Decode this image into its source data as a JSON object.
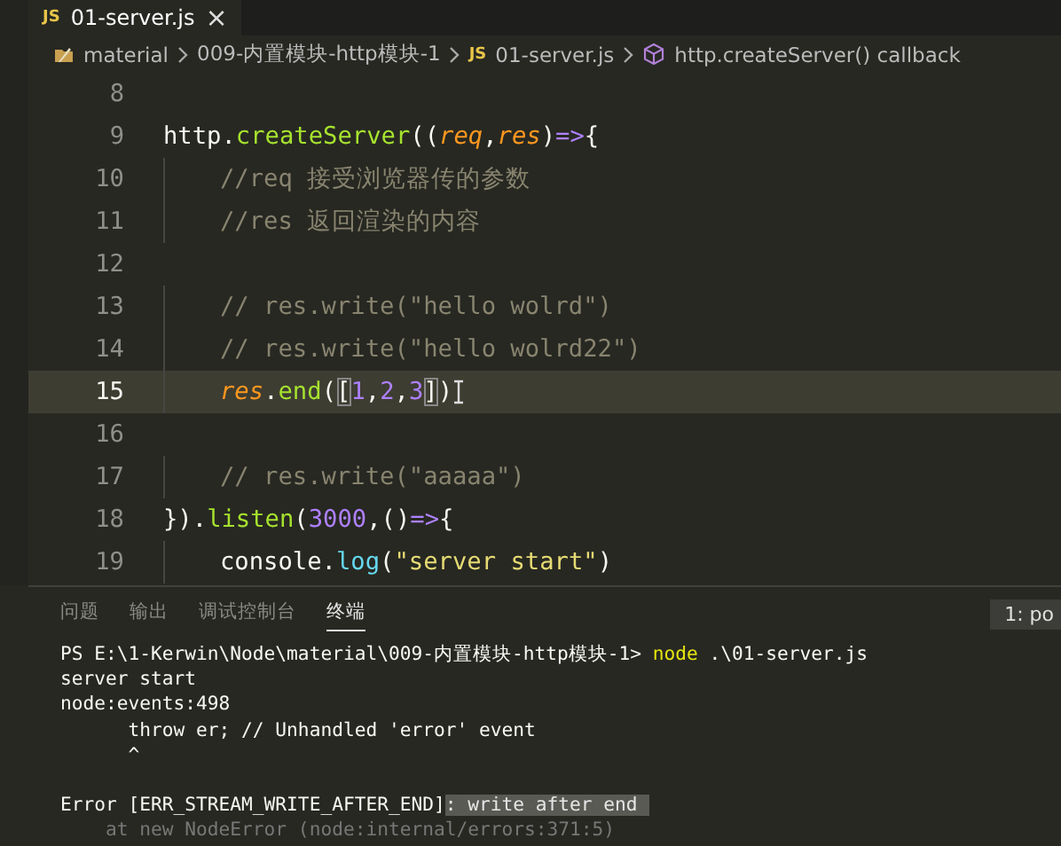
{
  "editor_tabs": [
    {
      "badge": "JS",
      "label": "01-server.js",
      "close": "×",
      "selected": true
    }
  ],
  "breadcrumb": [
    {
      "kind": "folder",
      "label": "material"
    },
    {
      "kind": "folder-plain",
      "label": "009-内置模块-http模块-1"
    },
    {
      "kind": "file",
      "badge": "JS",
      "label": "01-server.js"
    },
    {
      "kind": "symbol",
      "label": "http.createServer() callback"
    }
  ],
  "editor": {
    "lines": [
      {
        "number": "8",
        "current": false
      },
      {
        "number": "9",
        "current": false,
        "tokens": [
          {
            "text": "http.",
            "kind": "plain"
          },
          {
            "text": "createServer",
            "kind": "func"
          },
          {
            "text": "((",
            "kind": "plain"
          },
          {
            "text": "req",
            "kind": "param"
          },
          {
            "text": ",",
            "kind": "plain"
          },
          {
            "text": "res",
            "kind": "param"
          },
          {
            "text": ")",
            "kind": "plain"
          },
          {
            "text": "=>",
            "kind": "operator"
          },
          {
            "text": "{",
            "kind": "plain"
          }
        ]
      },
      {
        "number": "10",
        "current": false,
        "indent": true,
        "tokens": [
          {
            "text": "//req 接受浏览器传的参数",
            "kind": "comment"
          }
        ]
      },
      {
        "number": "11",
        "current": false,
        "indent": true,
        "tokens": [
          {
            "text": "//res 返回渲染的内容",
            "kind": "comment"
          }
        ]
      },
      {
        "number": "12",
        "current": false
      },
      {
        "number": "13",
        "current": false,
        "indent": true,
        "tokens": [
          {
            "text": "// res.write(\"hello wolrd\")",
            "kind": "comment"
          }
        ]
      },
      {
        "number": "14",
        "current": false,
        "indent": true,
        "tokens": [
          {
            "text": "// res.write(\"hello wolrd22\")",
            "kind": "comment"
          }
        ]
      },
      {
        "number": "15",
        "current": true,
        "indent": true,
        "tokens": [
          {
            "text": "res",
            "kind": "param"
          },
          {
            "text": ".",
            "kind": "plain"
          },
          {
            "text": "end",
            "kind": "func"
          },
          {
            "text": "(",
            "kind": "plain"
          },
          {
            "text": "[",
            "kind": "bracket-match"
          },
          {
            "text": "1",
            "kind": "number"
          },
          {
            "text": ",",
            "kind": "plain"
          },
          {
            "text": "2",
            "kind": "number"
          },
          {
            "text": ",",
            "kind": "plain"
          },
          {
            "text": "3",
            "kind": "number"
          },
          {
            "text": "]",
            "kind": "bracket-match"
          },
          {
            "text": ")",
            "kind": "plain"
          }
        ]
      },
      {
        "number": "16",
        "current": false
      },
      {
        "number": "17",
        "current": false,
        "indent": true,
        "tokens": [
          {
            "text": "// res.write(\"aaaaa\")",
            "kind": "comment"
          }
        ]
      },
      {
        "number": "18",
        "current": false,
        "tokens": [
          {
            "text": "}).",
            "kind": "plain"
          },
          {
            "text": "listen",
            "kind": "func"
          },
          {
            "text": "(",
            "kind": "plain"
          },
          {
            "text": "3000",
            "kind": "number"
          },
          {
            "text": ",()",
            "kind": "plain"
          },
          {
            "text": "=>",
            "kind": "operator"
          },
          {
            "text": "{",
            "kind": "plain"
          }
        ]
      },
      {
        "number": "19",
        "current": false,
        "indent": true,
        "tokens": [
          {
            "text": "console.",
            "kind": "plain"
          },
          {
            "text": "log",
            "kind": "method"
          },
          {
            "text": "(",
            "kind": "plain"
          },
          {
            "text": "\"server start\"",
            "kind": "string"
          },
          {
            "text": ")",
            "kind": "plain"
          }
        ]
      }
    ]
  },
  "panel": {
    "tabs": [
      {
        "label": "问题",
        "selected": false
      },
      {
        "label": "输出",
        "selected": false
      },
      {
        "label": "调试控制台",
        "selected": false
      },
      {
        "label": "终端",
        "selected": true
      }
    ],
    "terminal_selector": "1: po",
    "terminal_lines": [
      {
        "tokens": [
          {
            "text": "PS E:\\1-Kerwin\\Node\\material\\009-内置模块-http模块-1> ",
            "kind": "plain"
          },
          {
            "text": "node",
            "kind": "command"
          },
          {
            "text": " .\\01-server.js",
            "kind": "plain"
          }
        ]
      },
      {
        "tokens": [
          {
            "text": "server start",
            "kind": "plain"
          }
        ]
      },
      {
        "tokens": [
          {
            "text": "node:events:498",
            "kind": "plain"
          }
        ]
      },
      {
        "tokens": [
          {
            "text": "      throw er; // Unhandled 'error' event",
            "kind": "plain"
          }
        ]
      },
      {
        "tokens": [
          {
            "text": "      ^",
            "kind": "plain"
          }
        ]
      },
      {
        "blank_before": true,
        "tokens": [
          {
            "text": "Error [ERR_STREAM_WRITE_AFTER_END]",
            "kind": "plain"
          },
          {
            "text": ": write after end ",
            "kind": "selection"
          }
        ]
      },
      {
        "tokens": [
          {
            "text": "    at new NodeError (node:internal/errors:371:5)",
            "kind": "dim"
          }
        ]
      }
    ]
  }
}
